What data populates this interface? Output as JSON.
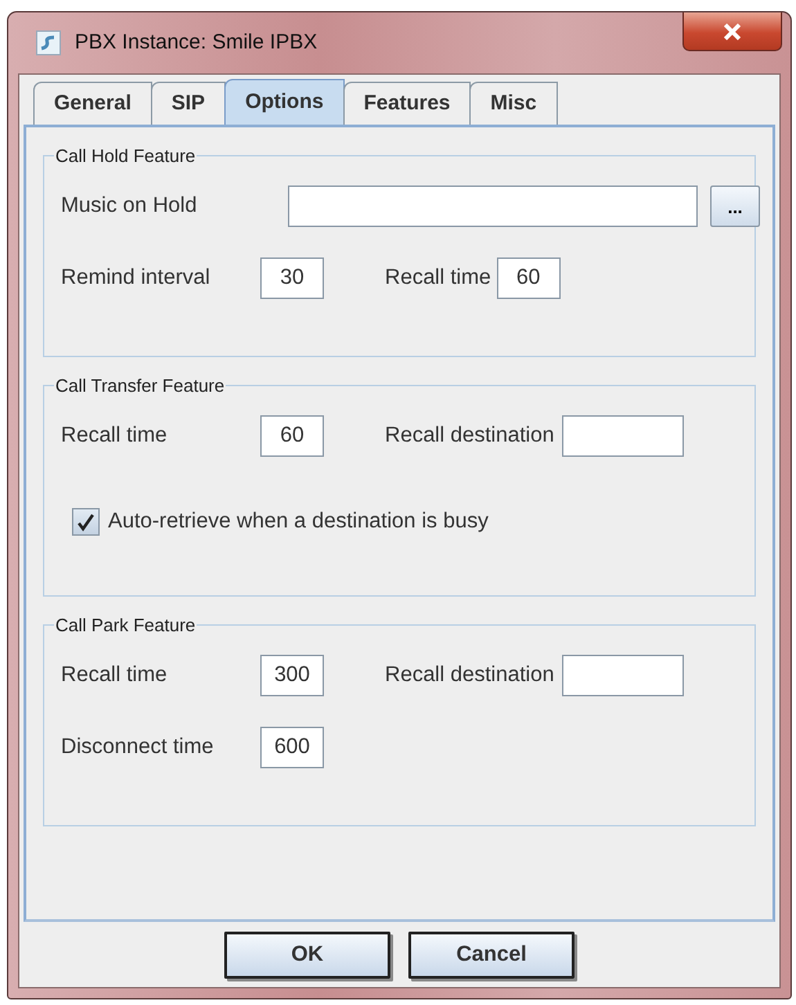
{
  "window": {
    "title": "PBX Instance: Smile IPBX"
  },
  "tabs": [
    {
      "label": "General",
      "selected": false
    },
    {
      "label": "SIP",
      "selected": false
    },
    {
      "label": "Options",
      "selected": true
    },
    {
      "label": "Features",
      "selected": false
    },
    {
      "label": "Misc",
      "selected": false
    }
  ],
  "groups": [
    {
      "title": "Call Hold Feature",
      "rows": [
        [
          {
            "kind": "file",
            "label": "Music on Hold",
            "button": "..."
          }
        ],
        [
          {
            "kind": "number",
            "label": "Remind interval",
            "value": "30"
          },
          {
            "kind": "number",
            "label": "Recall time",
            "value": "60"
          }
        ]
      ]
    },
    {
      "title": "Call Transfer Feature",
      "rows": [
        [
          {
            "kind": "number",
            "label": "Recall time",
            "value": "60"
          },
          {
            "kind": "text",
            "label": "Recall destination"
          }
        ],
        [
          {
            "kind": "checkbox",
            "label": "Auto-retrieve when a destination is busy",
            "checked": true
          }
        ]
      ]
    },
    {
      "title": "Call Park Feature",
      "rows": [
        [
          {
            "kind": "number",
            "label": "Recall time",
            "value": "300"
          },
          {
            "kind": "text",
            "label": "Recall destination"
          }
        ],
        [
          {
            "kind": "number",
            "label": "Disconnect time",
            "value": "600"
          }
        ]
      ]
    }
  ],
  "buttons": [
    "OK",
    "Cancel"
  ]
}
